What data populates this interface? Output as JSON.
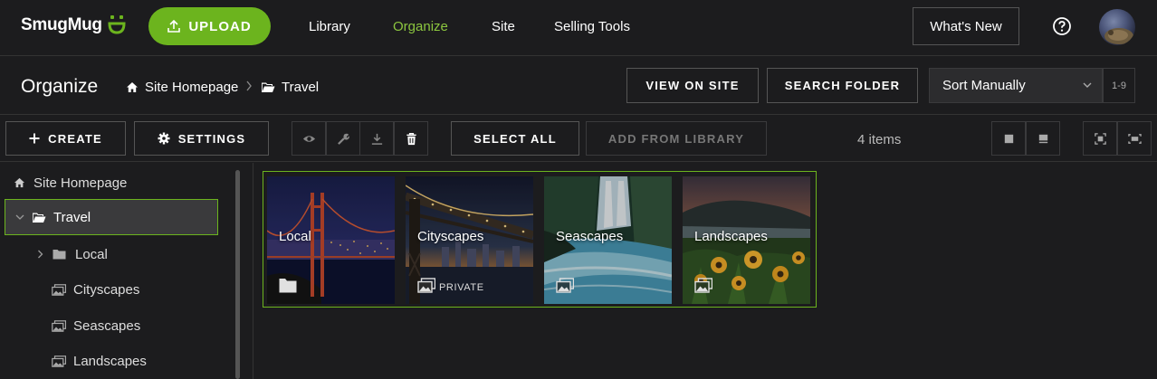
{
  "brand": {
    "name": "SmugMug",
    "accent": "#6cb41e",
    "nav_active": "#8cc63f"
  },
  "topnav": {
    "upload_label": "UPLOAD",
    "links": [
      "Library",
      "Organize",
      "Site",
      "Selling Tools"
    ],
    "active_link": "Organize",
    "whats_new_label": "What's New"
  },
  "header": {
    "title": "Organize",
    "breadcrumb": [
      "Site Homepage",
      "Travel"
    ],
    "view_on_site_label": "VIEW ON SITE",
    "search_folder_label": "SEARCH FOLDER",
    "sort_value": "Sort Manually",
    "range_label": "1-9"
  },
  "toolbar": {
    "create_label": "CREATE",
    "settings_label": "SETTINGS",
    "select_all_label": "SELECT ALL",
    "add_from_library_label": "ADD FROM LIBRARY",
    "items_count": "4 items",
    "icon_buttons": [
      "eye-icon",
      "wrench-icon",
      "download-icon",
      "trash-icon"
    ],
    "view_buttons": [
      "grid-large-icon",
      "grid-small-icon",
      "fit-icon",
      "fill-icon"
    ]
  },
  "sidebar": {
    "items": [
      {
        "label": "Site Homepage",
        "icon": "home-icon"
      },
      {
        "label": "Travel",
        "icon": "folder-open-icon",
        "selected": true,
        "expanded": true
      },
      {
        "label": "Local",
        "icon": "folder-icon",
        "collapsed": true
      },
      {
        "label": "Cityscapes",
        "icon": "gallery-icon"
      },
      {
        "label": "Seascapes",
        "icon": "gallery-icon"
      },
      {
        "label": "Landscapes",
        "icon": "gallery-icon"
      }
    ]
  },
  "gallery": {
    "tiles": [
      {
        "title": "Local",
        "icon": "folder-icon",
        "badge": ""
      },
      {
        "title": "Cityscapes",
        "icon": "gallery-icon",
        "badge": "PRIVATE"
      },
      {
        "title": "Seascapes",
        "icon": "gallery-icon",
        "badge": ""
      },
      {
        "title": "Landscapes",
        "icon": "gallery-icon",
        "badge": ""
      }
    ]
  }
}
